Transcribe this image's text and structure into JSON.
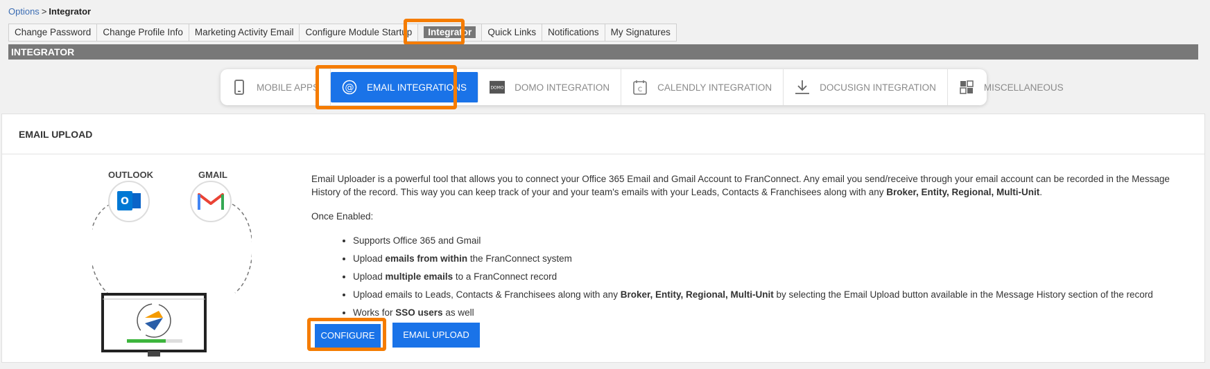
{
  "breadcrumb": {
    "parent": "Options",
    "separator": ">",
    "current": "Integrator"
  },
  "tabs": [
    {
      "label": "Change Password"
    },
    {
      "label": "Change Profile Info"
    },
    {
      "label": "Marketing Activity Email"
    },
    {
      "label": "Configure Module Startup"
    },
    {
      "label": "Integrator"
    },
    {
      "label": "Quick Links"
    },
    {
      "label": "Notifications"
    },
    {
      "label": "My Signatures"
    }
  ],
  "section_title": "INTEGRATOR",
  "subnav": [
    {
      "label": "MOBILE APPS",
      "icon": "mobile-phone-icon"
    },
    {
      "label": "EMAIL INTEGRATIONS",
      "icon": "at-sign-icon"
    },
    {
      "label": "DOMO INTEGRATION",
      "icon": "domo-logo-icon"
    },
    {
      "label": "CALENDLY INTEGRATION",
      "icon": "calendar-icon"
    },
    {
      "label": "DOCUSIGN INTEGRATION",
      "icon": "download-icon"
    },
    {
      "label": "MISCELLANEOUS",
      "icon": "grid-icon"
    }
  ],
  "card": {
    "title": "EMAIL UPLOAD",
    "illustration": {
      "outlook_label": "OUTLOOK",
      "gmail_label": "GMAIL",
      "domo_text": "DOMO"
    },
    "intro_1": "Email Uploader is a powerful tool that allows you to connect your Office 365 Email and Gmail Account to FranConnect. Any email you send/receive through your email account can be recorded in the Message History of the record. This way you can keep track of your and your team's emails with your Leads, Contacts & Franchisees along with any ",
    "intro_bold": "Broker, Entity, Regional, Multi-Unit",
    "intro_end": ".",
    "once_enabled": "Once Enabled:",
    "bullets": {
      "b1": "Supports Office 365 and Gmail",
      "b2_pre": "Upload ",
      "b2_bold": "emails from within",
      "b2_post": " the FranConnect system",
      "b3_pre": "Upload ",
      "b3_bold": "multiple emails",
      "b3_post": " to a FranConnect record",
      "b4_pre": "Upload emails to Leads, Contacts & Franchisees along with any ",
      "b4_bold": "Broker, Entity, Regional, Multi-Unit",
      "b4_post": " by selecting the Email Upload button available in the Message History section of the record",
      "b5_pre": "Works for ",
      "b5_bold": "SSO users",
      "b5_post": " as well"
    },
    "configure_label": "CONFIGURE",
    "email_upload_label": "EMAIL UPLOAD"
  },
  "colors": {
    "accent": "#1a73e8",
    "highlight": "#f57c00",
    "section_bar": "#787878"
  }
}
